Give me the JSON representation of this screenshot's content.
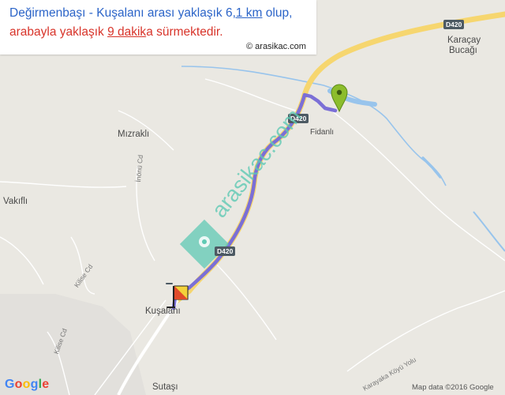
{
  "info": {
    "line1_pre": "Değirmenbaşı - Kuşalanı arası yaklaşık 6",
    "line1_distance": ",1 km",
    "line1_post": " olup,",
    "line2_pre": "arabayla yaklaşık ",
    "line2_time": "9 dakik",
    "line2_post": "a sürmektedir.",
    "credit": "© arasikac.com"
  },
  "places": {
    "karacay1": "Karaçay",
    "karacay2": "Bucağı",
    "fidanli": "Fidanlı",
    "mizrakli": "Mızraklı",
    "vakifli": "Vakıflı",
    "kusalani": "Kuşalanı",
    "sutasi": "Sutaşı"
  },
  "roads": {
    "d420_top": "D420",
    "d420_mid": "D420",
    "d420_low": "D420",
    "inonu": "İnönü Cd",
    "kilise1": "Kilise Cd",
    "kilise2": "Kilise Cd",
    "karayaka": "Karayaka Köyü Yolu"
  },
  "watermark": "arasikac.com",
  "google_logo": [
    "G",
    "o",
    "o",
    "g",
    "l",
    "e"
  ],
  "attribution": "Map data ©2016 Google",
  "colors": {
    "route": "#7b6fd6",
    "highway": "#f6d66f",
    "water": "#98c4ec",
    "marker": "#8cbd2c",
    "watermark": "#5fcab4"
  },
  "icons": {
    "start_marker": "green-pin-icon",
    "end_marker": "finish-flag-icon",
    "watermark_pin": "location-pin-icon"
  }
}
